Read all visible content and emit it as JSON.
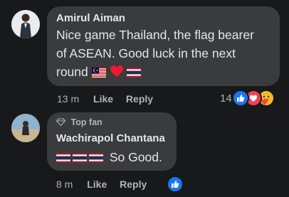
{
  "comments": [
    {
      "author": "Amirul Aiman",
      "text_line1": "Nice game Thailand, the flag bearer",
      "text_line2": "of ASEAN. Good luck in the next",
      "text_line3": "round",
      "time": "13 m",
      "like_label": "Like",
      "reply_label": "Reply",
      "reaction_count": "14",
      "reactions": [
        "like-icon",
        "love-icon",
        "care-icon"
      ]
    },
    {
      "badge": "Top fan",
      "author": "Wachirapol Chantana",
      "text": "So Good.",
      "time": "8 m",
      "like_label": "Like",
      "reply_label": "Reply",
      "reactions": [
        "like-icon"
      ]
    }
  ],
  "colors": {
    "background": "#18191a",
    "bubble": "#3a3b3c",
    "like_blue": "#1877f2",
    "love_red": "#f33e58",
    "care_yellow": "#f7b928"
  }
}
